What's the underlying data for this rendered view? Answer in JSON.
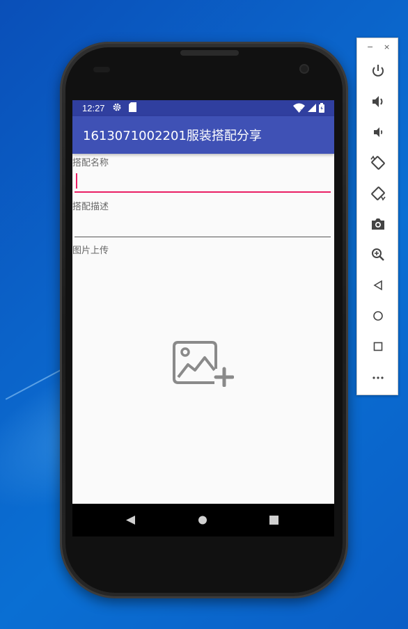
{
  "status_bar": {
    "time": "12:27",
    "icons": [
      "gear-icon",
      "sd-card-icon",
      "wifi-icon",
      "signal-icon",
      "battery-icon"
    ]
  },
  "app_bar": {
    "title": "1613071002201服装搭配分享"
  },
  "form": {
    "name_label": "搭配名称",
    "name_value": "",
    "description_label": "搭配描述",
    "description_value": "",
    "image_label": "图片上传",
    "upload_icon": "add-image-icon"
  },
  "nav_bar": {
    "buttons": [
      "back-triangle-icon",
      "home-circle-icon",
      "recents-square-icon"
    ]
  },
  "emulator_toolbar": {
    "minimize": "−",
    "close": "×",
    "buttons": [
      "power-icon",
      "volume-up-icon",
      "volume-down-icon",
      "rotate-left-icon",
      "rotate-right-icon",
      "camera-icon",
      "zoom-icon",
      "back-icon",
      "home-icon",
      "overview-icon",
      "more-icon"
    ]
  },
  "colors": {
    "status_bar": "#303f9f",
    "app_bar": "#3f51b5",
    "accent": "#e91e63"
  }
}
